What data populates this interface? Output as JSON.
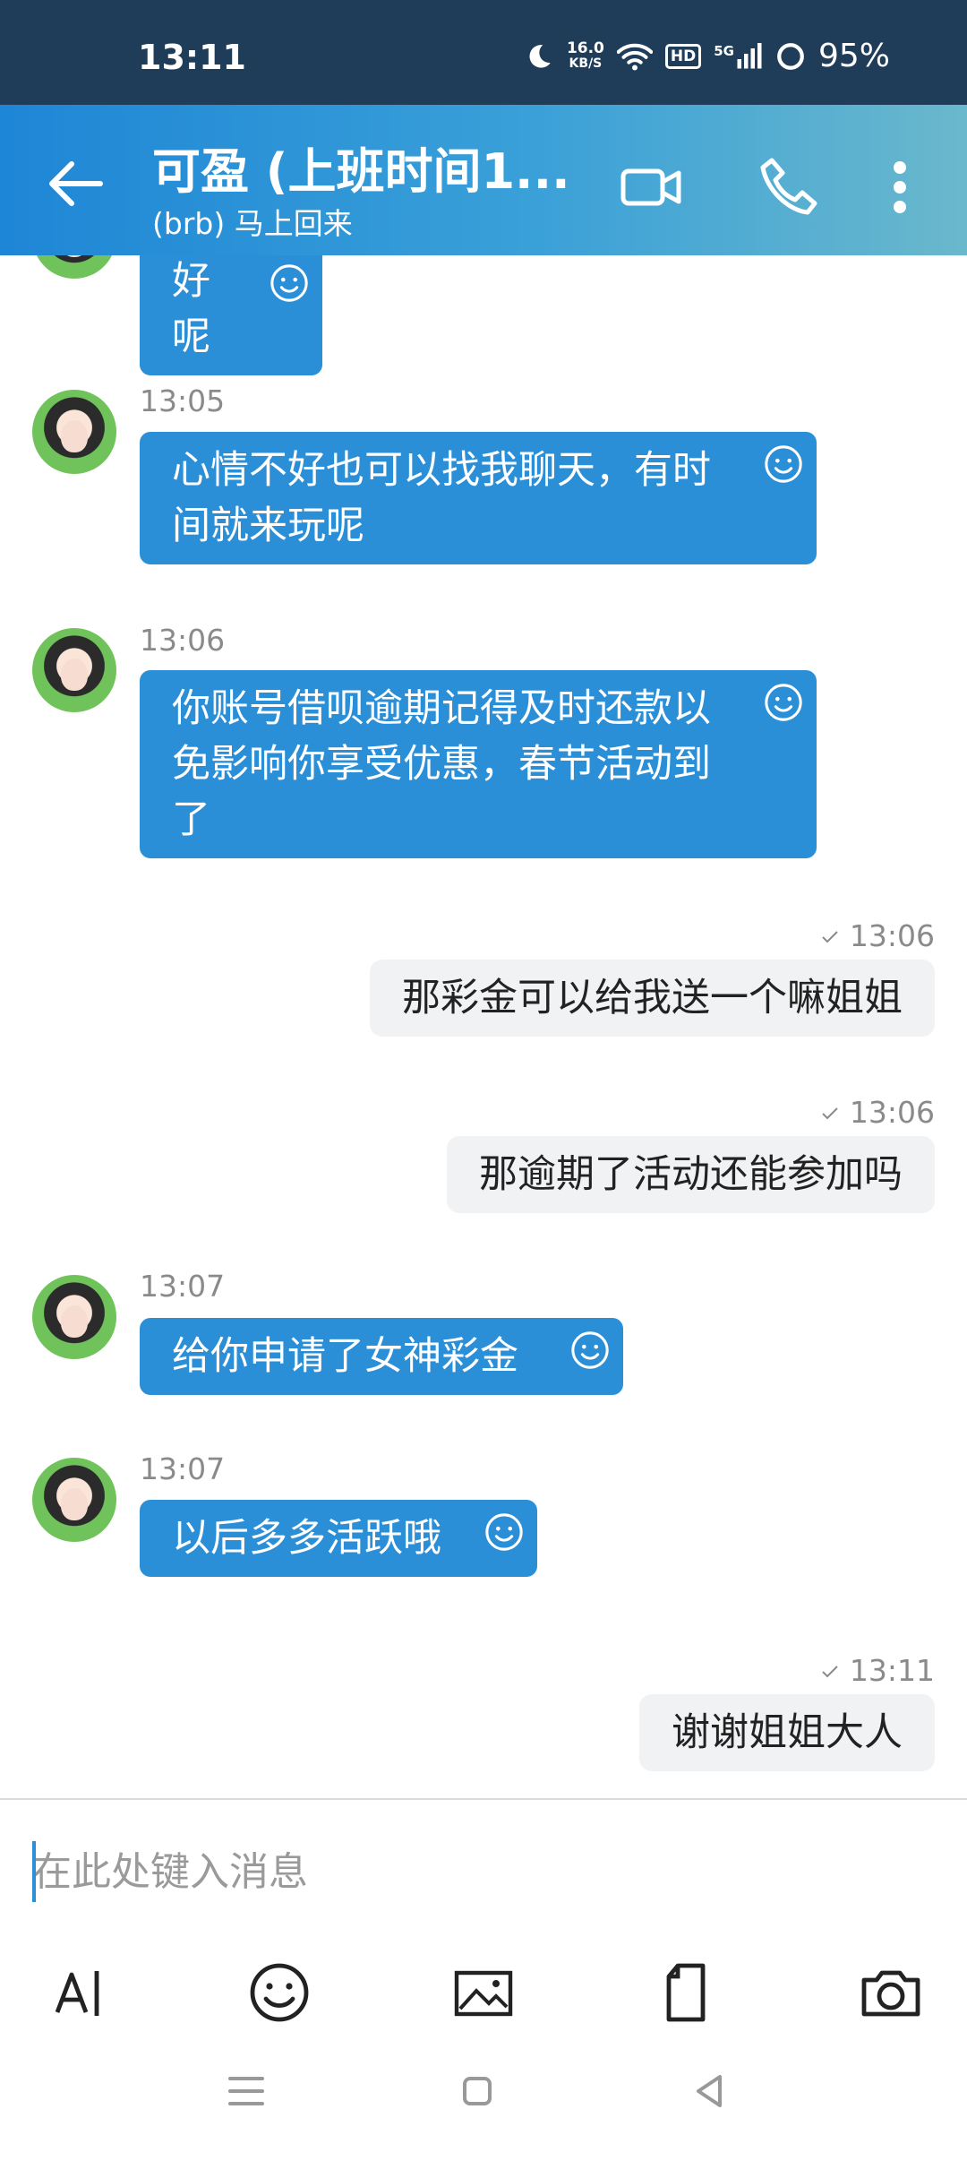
{
  "status_bar": {
    "time": "13:11",
    "net_speed_top": "16.0",
    "net_speed_unit": "KB/S",
    "hd": "HD",
    "network": "5G",
    "battery": "95%"
  },
  "header": {
    "title": "可盈 (上班时间1...",
    "subtitle": "(brb) 马上回来",
    "icons": [
      "back-arrow-icon",
      "video-call-icon",
      "phone-icon",
      "more-vert-icon"
    ]
  },
  "messages": [
    {
      "direction": "in",
      "time": "",
      "text": "好呢"
    },
    {
      "direction": "in",
      "time": "13:05",
      "text": "心情不好也可以找我聊天，有时间就来玩呢"
    },
    {
      "direction": "in",
      "time": "13:06",
      "text": "你账号借呗逾期记得及时还款以免影响你享受优惠，春节活动到了"
    },
    {
      "direction": "out",
      "time": "13:06",
      "text": "那彩金可以给我送一个嘛姐姐"
    },
    {
      "direction": "out",
      "time": "13:06",
      "text": "那逾期了活动还能参加吗"
    },
    {
      "direction": "in",
      "time": "13:07",
      "text": "给你申请了女神彩金"
    },
    {
      "direction": "in",
      "time": "13:07",
      "text": "以后多多活跃哦"
    },
    {
      "direction": "out",
      "time": "13:11",
      "text": "谢谢姐姐大人"
    }
  ],
  "input": {
    "placeholder": "在此处键入消息",
    "value": ""
  },
  "toolbar": [
    "text-format-icon",
    "emoji-icon",
    "image-icon",
    "file-icon",
    "camera-icon"
  ],
  "colors": {
    "status_bar": "#1f3d58",
    "header_start": "#1e86d6",
    "header_end": "#6ab8cc",
    "bubble_in": "#2b8fd8",
    "bubble_out": "#f1f2f4"
  }
}
